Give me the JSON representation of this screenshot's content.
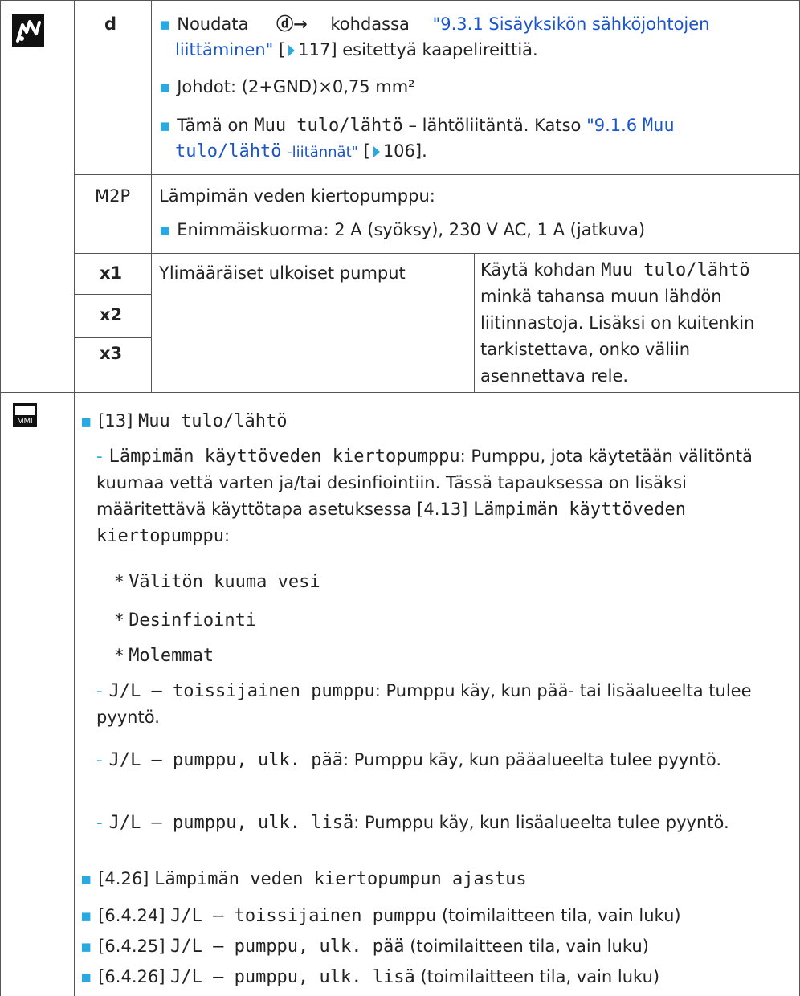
{
  "row_d": {
    "label": "d",
    "b1_pre": "Noudata",
    "b1_symbol": "ⓓ→",
    "b1_mid": "kohdassa",
    "b1_link_a": "\"9.3.1 Sisäyksikön sähköjohtojen",
    "b1_link_b": "liittäminen\"",
    "b1_ref": "117",
    "b1_post": "esitettyä kaapelireittiä.",
    "b2": "Johdot: (2+GND)×0,75 mm²",
    "b3_pre": "Tämä on",
    "b3_mono": "Muu tulo/lähtö",
    "b3_mid": "– lähtöliitäntä. Katso",
    "b3_link_a": "\"9.1.6",
    "b3_link_mono_a": "Muu",
    "b3_link_mono_b": "tulo/lähtö",
    "b3_link_b": "-liitännät\"",
    "b3_ref": "106"
  },
  "row_m2p": {
    "label": "M2P",
    "title": "Lämpimän veden kiertopumppu:",
    "b1": "Enimmäiskuorma: 2 A (syöksy), 230 V AC, 1 A (jatkuva)"
  },
  "row_x": {
    "labels": [
      "x1",
      "x2",
      "x3"
    ],
    "desc": "Ylimääräiset ulkoiset pumput",
    "note_pre": "Käytä kohdan",
    "note_mono": "Muu tulo/lähtö",
    "note_rest": "minkä tahansa muun lähdön liitinnastoja. Lisäksi on kuitenkin tarkistettava, onko väliin asennettava rele."
  },
  "mmi": {
    "icon_label": "MMI",
    "item13_code": "[13]",
    "item13_mono": "Muu tulo/lähtö",
    "sub1_mono": "Lämpimän käyttöveden kiertopumppu",
    "sub1_text": ": Pumppu, jota käytetään välitöntä kuumaa vettä varten ja/tai desinfiointiin. Tässä tapauksessa on lisäksi määritettävä käyttötapa asetuksessa [4.13]",
    "sub1_mono2": "Lämpimän käyttöveden kiertopumppu",
    "sub1_end": ":",
    "opt1": "Välitön kuuma vesi",
    "opt2": "Desinfiointi",
    "opt3": "Molemmat",
    "sub2_mono": "J/L – toissijainen pumppu",
    "sub2_text": ": Pumppu käy, kun pää- tai lisäalueelta tulee pyyntö.",
    "sub3_mono": "J/L – pumppu, ulk. pää",
    "sub3_text": ": Pumppu käy, kun pääalueelta tulee pyyntö.",
    "sub4_mono": "J/L – pumppu, ulk. lisä",
    "sub4_text": ": Pumppu käy, kun lisäalueelta tulee pyyntö.",
    "b2_code": "[4.26]",
    "b2_mono": "Lämpimän veden kiertopumpun ajastus",
    "b3_code": "[6.4.24]",
    "b3_mono": "J/L – toissijainen pumppu",
    "b3_text": "(toimilaitteen tila, vain luku)",
    "b4_code": "[6.4.25]",
    "b4_mono": "J/L – pumppu, ulk. pää",
    "b4_text": "(toimilaitteen tila, vain luku)",
    "b5_code": "[6.4.26]",
    "b5_mono": "J/L – pumppu, ulk. lisä",
    "b5_text": "(toimilaitteen tila, vain luku)"
  }
}
